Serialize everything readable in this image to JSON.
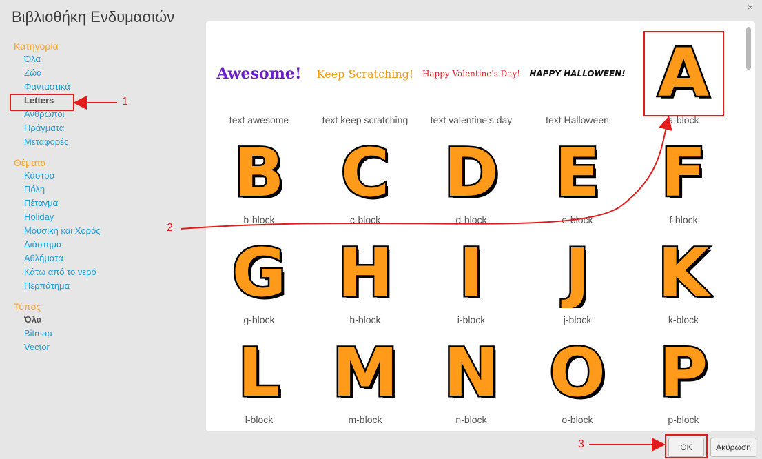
{
  "dialog": {
    "title": "Βιβλιοθήκη Ενδυμασιών",
    "close": "×"
  },
  "sidebar": {
    "category": {
      "heading": "Κατηγορία",
      "items": [
        "Όλα",
        "Ζώα",
        "Φανταστικά",
        "Letters",
        "Άνθρωποι",
        "Πράγματα",
        "Μεταφορές"
      ],
      "selected": "Letters"
    },
    "themes": {
      "heading": "Θέματα",
      "items": [
        "Κάστρο",
        "Πόλη",
        "Πέταγμα",
        "Holiday",
        "Μουσική και Χορός",
        "Διάστημα",
        "Αθλήματα",
        "Κάτω από το νερό",
        "Περπάτημα"
      ]
    },
    "type": {
      "heading": "Τύπος",
      "items": [
        "Όλα",
        "Bitmap",
        "Vector"
      ],
      "selected": "Όλα"
    }
  },
  "costumes": {
    "row1": [
      {
        "label": "text awesome",
        "art": "Awesome!"
      },
      {
        "label": "text keep scratching",
        "art": "Keep Scratching!"
      },
      {
        "label": "text valentine's day",
        "art": "Happy Valentine's Day!"
      },
      {
        "label": "text Halloween",
        "art": "HAPPY HALLOWEEN!"
      },
      {
        "label": "a-block",
        "glyph": "A"
      }
    ],
    "letters": [
      {
        "label": "b-block",
        "glyph": "B"
      },
      {
        "label": "c-block",
        "glyph": "C"
      },
      {
        "label": "d-block",
        "glyph": "D"
      },
      {
        "label": "e-block",
        "glyph": "E"
      },
      {
        "label": "f-block",
        "glyph": "F"
      },
      {
        "label": "g-block",
        "glyph": "G"
      },
      {
        "label": "h-block",
        "glyph": "H"
      },
      {
        "label": "i-block",
        "glyph": "I"
      },
      {
        "label": "j-block",
        "glyph": "J"
      },
      {
        "label": "k-block",
        "glyph": "K"
      },
      {
        "label": "l-block",
        "glyph": "L"
      },
      {
        "label": "m-block",
        "glyph": "M"
      },
      {
        "label": "n-block",
        "glyph": "N"
      },
      {
        "label": "o-block",
        "glyph": "O"
      },
      {
        "label": "p-block",
        "glyph": "P"
      }
    ]
  },
  "buttons": {
    "ok": "OK",
    "cancel": "Ακύρωση"
  },
  "annotations": {
    "one": "1",
    "two": "2",
    "three": "3"
  },
  "colors": {
    "letter_fill": "#ff9a1a",
    "letter_stroke": "#000000",
    "annotation": "#e21c1c",
    "link": "#1c9ed8",
    "section": "#f5a623"
  }
}
